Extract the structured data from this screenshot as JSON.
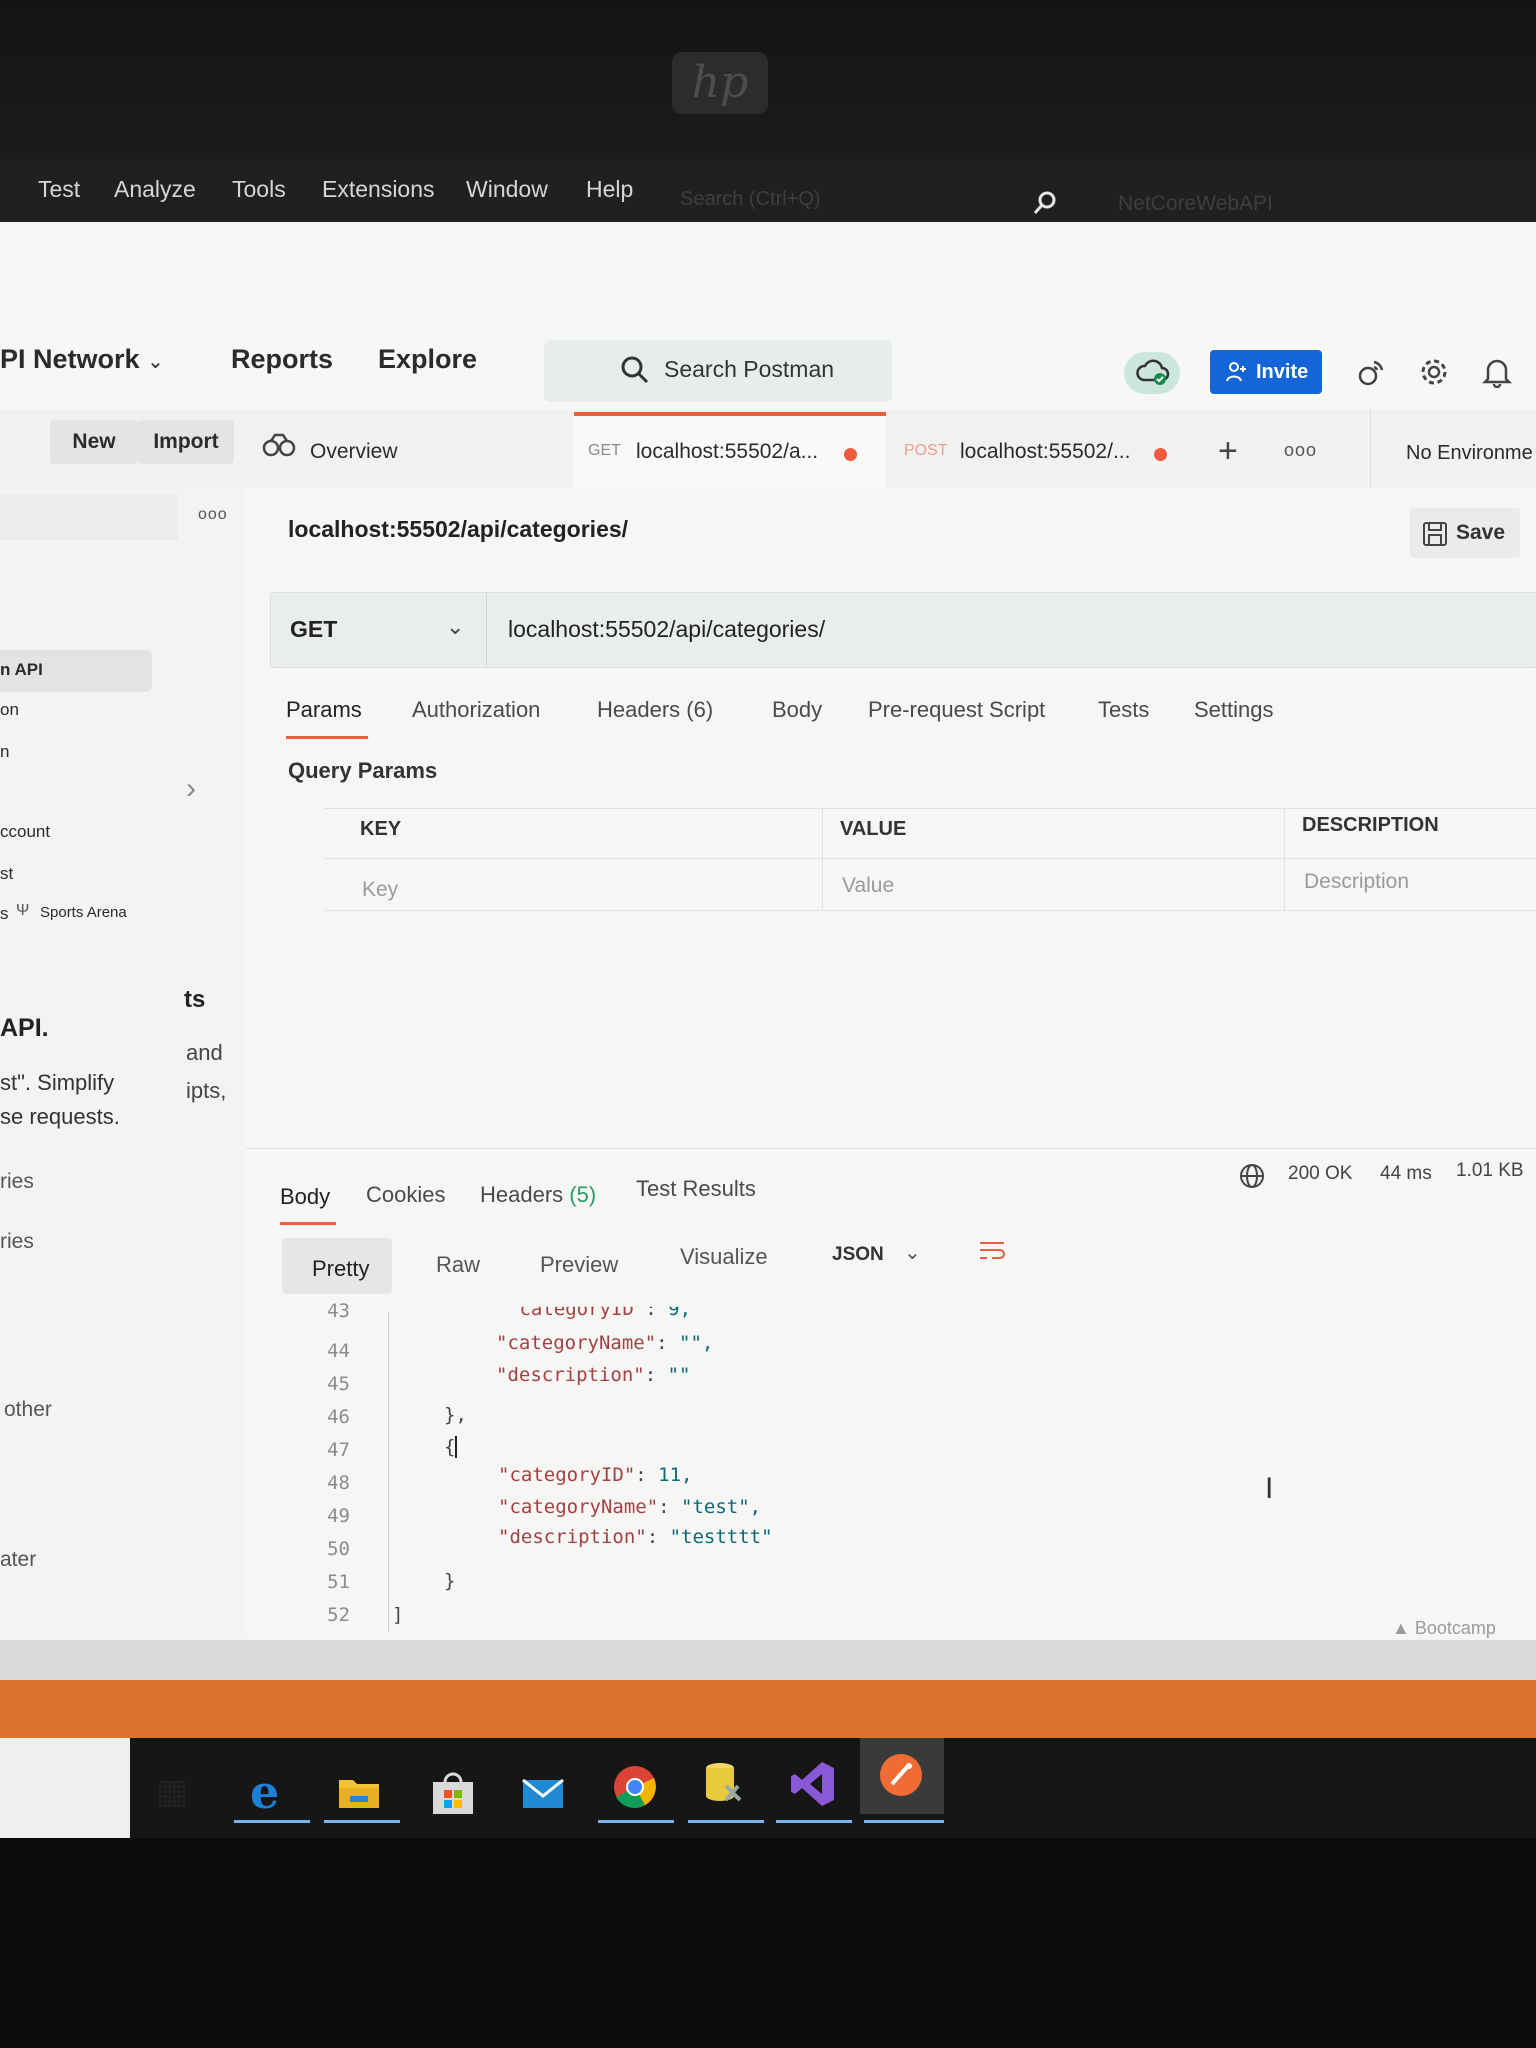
{
  "vs_menu": {
    "items": [
      "Test",
      "Analyze",
      "Tools",
      "Extensions",
      "Window",
      "Help"
    ],
    "search_placeholder": "Search (Ctrl+Q)",
    "solution_title": "NetCoreWebAPI"
  },
  "header": {
    "workspace": "PI Network",
    "nav": [
      "Reports",
      "Explore"
    ],
    "search": "Search Postman",
    "invite": "Invite"
  },
  "tabrow": {
    "new": "New",
    "import": "Import",
    "overview": "Overview",
    "tabs": [
      {
        "method": "GET",
        "label": "localhost:55502/a...",
        "method_color": "#8a8a8a"
      },
      {
        "method": "POST",
        "label": "localhost:55502/...",
        "method_color": "#e8a08b"
      }
    ],
    "environment": "No Environme"
  },
  "sidebar": {
    "items": [
      "n API",
      "on",
      "n",
      "ccount",
      "st",
      "s",
      "Sports Arena"
    ],
    "promo": {
      "title": "API.",
      "line1": "st\". Simplify",
      "line2": "se requests."
    },
    "promo2": {
      "heading": "ts",
      "line1": "and",
      "line2": "ipts,"
    },
    "lower": [
      "ries",
      "ries",
      "other",
      "ater"
    ]
  },
  "request": {
    "title": "localhost:55502/api/categories/",
    "save": "Save",
    "method": "GET",
    "url": "localhost:55502/api/categories/",
    "tabs": [
      "Params",
      "Authorization",
      "Headers (6)",
      "Body",
      "Pre-request Script",
      "Tests",
      "Settings"
    ],
    "query_params": "Query Params",
    "columns": [
      "KEY",
      "VALUE",
      "DESCRIPTION"
    ],
    "placeholders": [
      "Key",
      "Value",
      "Description"
    ]
  },
  "response": {
    "tabs": [
      "Body",
      "Cookies",
      "Headers",
      "Test Results"
    ],
    "headers_count": "(5)",
    "status": "200 OK",
    "time": "44 ms",
    "size": "1.01 KB",
    "formats": [
      "Pretty",
      "Raw",
      "Preview",
      "Visualize"
    ],
    "language": "JSON",
    "line_numbers": [
      "43",
      "44",
      "45",
      "46",
      "47",
      "48",
      "49",
      "50",
      "51",
      "52"
    ],
    "code": {
      "l43_key": "\"categoryID\"",
      "l43_val": "9,",
      "l44_key": "\"categoryName\"",
      "l44_val": "\"\",",
      "l45_key": "\"description\"",
      "l45_val": "\"\"",
      "l46": "},",
      "l47": "{",
      "l48_key": "\"categoryID\"",
      "l48_val": "11,",
      "l49_key": "\"categoryName\"",
      "l49_val": "\"test\",",
      "l50_key": "\"description\"",
      "l50_val": "\"testttt\"",
      "l51": "}",
      "l52": "]"
    },
    "bootcamp": "Bootcamp"
  },
  "colors": {
    "accent": "#ef5b3d",
    "invite": "#1565d8",
    "taskbar_accent": "#78b4e6"
  }
}
